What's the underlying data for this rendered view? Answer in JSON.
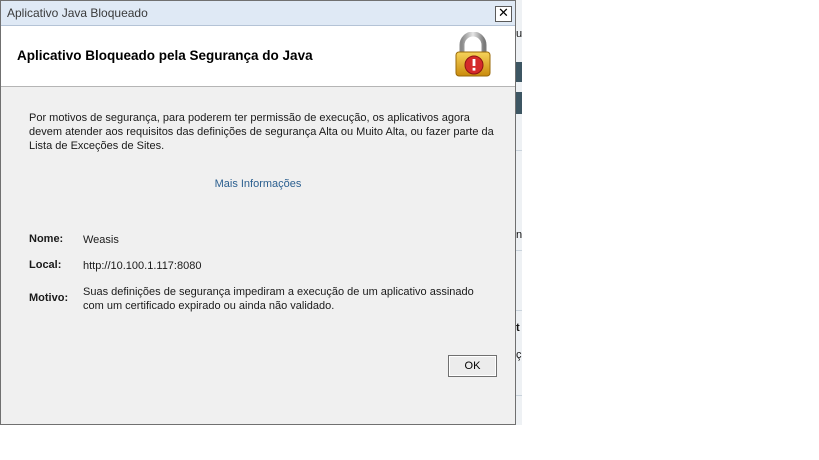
{
  "window": {
    "title": "Aplicativo Java Bloqueado",
    "close_symbol": "✕"
  },
  "header": {
    "title": "Aplicativo Bloqueado pela Segurança do Java",
    "icon": "lock-warning-icon"
  },
  "message": "Por motivos de segurança, para poderem ter permissão de execução, os aplicativos agora devem atender aos requisitos das definições de segurança Alta ou Muito Alta, ou fazer parte da Lista de Exceções de Sites.",
  "more_info_link": "Mais Informações",
  "fields": {
    "name_label": "Nome:",
    "name_value": "Weasis",
    "location_label": "Local:",
    "location_value": "http://10.100.1.117:8080",
    "reason_label": "Motivo:",
    "reason_value": "Suas definições de segurança impediram a execução de um aplicativo assinado com um certificado expirado ou ainda não validado."
  },
  "buttons": {
    "ok_label": "OK"
  },
  "background_app": {
    "glyphs": [
      "u",
      "n",
      "t",
      "ç"
    ]
  },
  "colors": {
    "titlebar": "#dfe9f5",
    "link": "#2b5f8f",
    "dialog_bg": "#f0f0f0",
    "lock_body": "#e8b21c",
    "warning_badge": "#d42a2a"
  }
}
